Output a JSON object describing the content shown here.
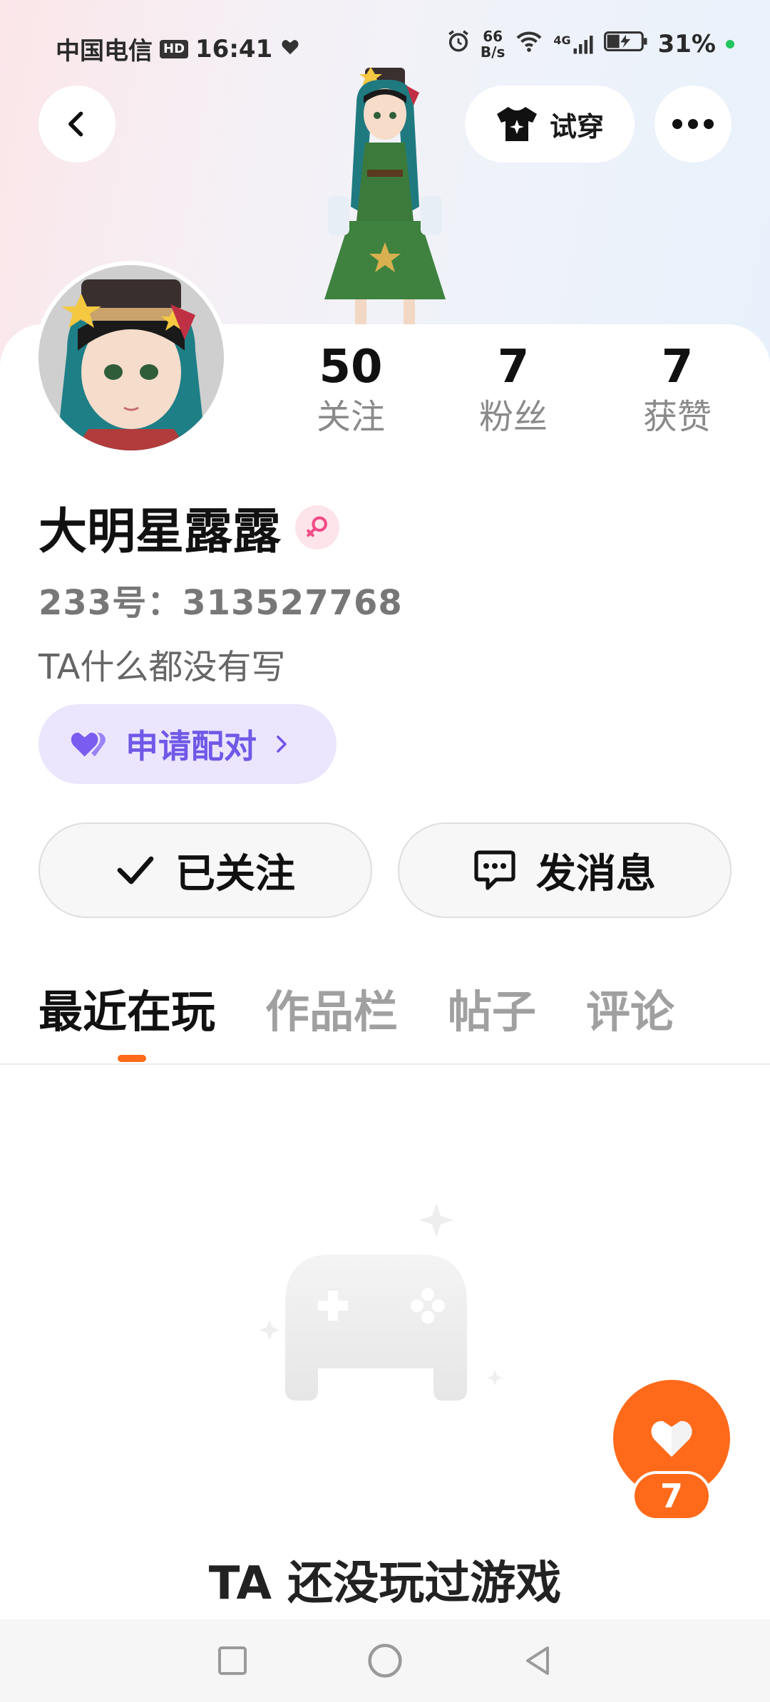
{
  "status_bar": {
    "carrier": "中国电信",
    "hd": "HD",
    "time": "16:41",
    "net_speed_value": "66",
    "net_speed_unit": "B/s",
    "signal_type": "4G",
    "battery": "31%"
  },
  "header": {
    "back_icon": "chevron-left-icon",
    "try_on_label": "试穿",
    "more_icon": "more-horizontal-icon"
  },
  "stats": [
    {
      "value": "50",
      "label": "关注"
    },
    {
      "value": "7",
      "label": "粉丝"
    },
    {
      "value": "7",
      "label": "获赞"
    }
  ],
  "profile": {
    "name": "大明星露露",
    "gender_icon": "female-icon",
    "uid": "233号：313527768",
    "bio": "TA什么都没有写"
  },
  "pair_button": {
    "label": "申请配对",
    "icon": "heart-icon"
  },
  "actions": {
    "follow_label": "已关注",
    "message_label": "发消息"
  },
  "tabs": [
    {
      "label": "最近在玩",
      "active": true
    },
    {
      "label": "作品栏",
      "active": false
    },
    {
      "label": "帖子",
      "active": false
    },
    {
      "label": "评论",
      "active": false
    }
  ],
  "empty_state": {
    "text": "TA 还没玩过游戏",
    "icon": "gamepad-icon"
  },
  "like_fab": {
    "count": "7",
    "icon": "heart-icon"
  },
  "colors": {
    "accent": "#ff6a1a",
    "pair_purple": "#7058e8",
    "pair_bg": "#ebe6fd"
  }
}
